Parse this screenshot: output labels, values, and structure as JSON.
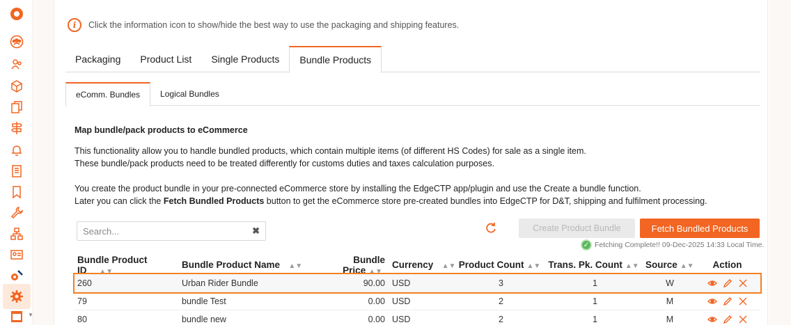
{
  "info": {
    "text": "Click the information icon to show/hide the best way to use the packaging and shipping features."
  },
  "tabs": [
    {
      "label": "Packaging"
    },
    {
      "label": "Product List"
    },
    {
      "label": "Single Products"
    },
    {
      "label": "Bundle Products"
    }
  ],
  "subtabs": [
    {
      "label": "eComm. Bundles"
    },
    {
      "label": "Logical Bundles"
    }
  ],
  "section": {
    "title": "Map bundle/pack products to eCommerce",
    "para1_line1": "This functionality allow you to handle bundled products, which contain multiple items (of different HS Codes) for sale as a single item.",
    "para1_line2": "These bundle/pack products need to be treated differently for customs duties and taxes calculation purposes.",
    "para2_line1": "You create the product bundle in your pre-connected eCommerce store by installing the EdgeCTP app/plugin and use the Create a bundle function.",
    "para2_line2_pre": "Later you can click the ",
    "para2_line2_bold": "Fetch Bundled Products",
    "para2_line2_post": " button to get the eCommerce store pre-created bundles into EdgeCTP for D&T, shipping and fulfilment processing."
  },
  "search": {
    "placeholder": "Search...",
    "value": ""
  },
  "buttons": {
    "create": "Create Product Bundle",
    "fetch": "Fetch Bundled Products"
  },
  "status": {
    "text": "Fetching Complete!! 09-Dec-2025 14:33 Local Time."
  },
  "table": {
    "headers": [
      "Bundle Product ID",
      "Bundle Product Name",
      "Bundle Price",
      "Currency",
      "Product Count",
      "Trans. Pk. Count",
      "Source",
      "Action"
    ],
    "rows": [
      {
        "id": "260",
        "name": "Urban Rider Bundle",
        "price": "90.00",
        "currency": "USD",
        "count": "3",
        "trans": "1",
        "source": "W"
      },
      {
        "id": "79",
        "name": "bundle Test",
        "price": "0.00",
        "currency": "USD",
        "count": "2",
        "trans": "1",
        "source": "M"
      },
      {
        "id": "80",
        "name": "bundle new",
        "price": "0.00",
        "currency": "USD",
        "count": "2",
        "trans": "1",
        "source": "M"
      }
    ]
  },
  "colors": {
    "accent": "#f26522",
    "success": "#5cb85c"
  }
}
